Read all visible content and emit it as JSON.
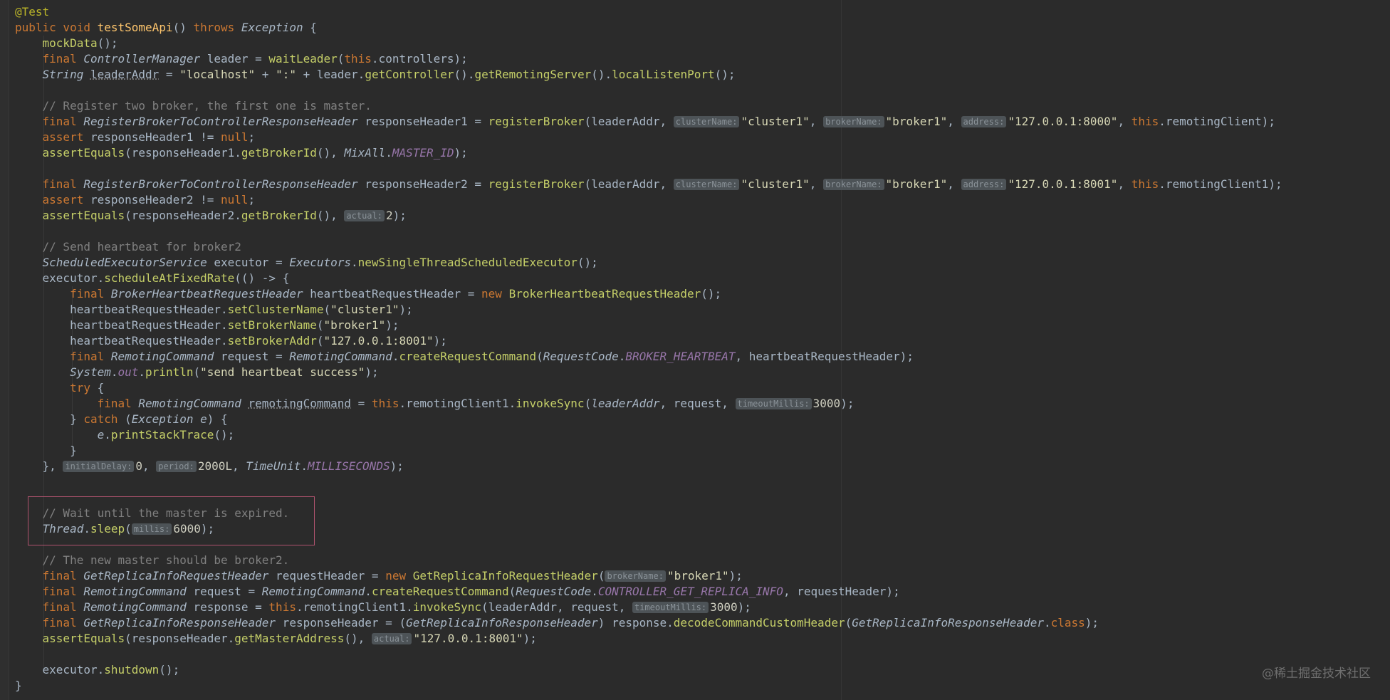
{
  "editor": {
    "watermark": "@稀土掘金技术社区",
    "lines": [
      [
        [
          "@Test",
          "ann"
        ]
      ],
      [
        [
          "public void ",
          "kw"
        ],
        [
          "testSomeApi",
          "fn"
        ],
        [
          "() "
        ],
        [
          "throws ",
          "kw"
        ],
        [
          "Exception",
          "type"
        ],
        [
          " {"
        ]
      ],
      [
        [
          "    "
        ],
        [
          "mockData",
          "call"
        ],
        [
          "();"
        ]
      ],
      [
        [
          "    "
        ],
        [
          "final ",
          "kw"
        ],
        [
          "ControllerManager",
          "type"
        ],
        [
          " leader = "
        ],
        [
          "waitLeader",
          "call"
        ],
        [
          "("
        ],
        [
          "this",
          "kw"
        ],
        [
          ".controllers);"
        ]
      ],
      [
        [
          "    "
        ],
        [
          "String",
          "type"
        ],
        [
          " "
        ],
        [
          "leaderAddr",
          "unused"
        ],
        [
          " = "
        ],
        [
          "\"localhost\"",
          "str"
        ],
        [
          " + "
        ],
        [
          "\":\"",
          "str"
        ],
        [
          " + leader."
        ],
        [
          "getController",
          "call"
        ],
        [
          "()."
        ],
        [
          "getRemotingServer",
          "call"
        ],
        [
          "()."
        ],
        [
          "localListenPort",
          "call"
        ],
        [
          "();"
        ]
      ],
      [],
      [
        [
          "    "
        ],
        [
          "// Register two broker, the first one is master.",
          "cmt"
        ]
      ],
      [
        [
          "    "
        ],
        [
          "final ",
          "kw"
        ],
        [
          "RegisterBrokerToControllerResponseHeader",
          "type"
        ],
        [
          " responseHeader1 = "
        ],
        [
          "registerBroker",
          "call"
        ],
        [
          "(leaderAddr, "
        ],
        [
          "clusterName:",
          "hint"
        ],
        [
          "\"cluster1\"",
          "str"
        ],
        [
          ", "
        ],
        [
          "brokerName:",
          "hint"
        ],
        [
          "\"broker1\"",
          "str"
        ],
        [
          ", "
        ],
        [
          "address:",
          "hint"
        ],
        [
          "\"127.0.0.1:8000\"",
          "str"
        ],
        [
          ", "
        ],
        [
          "this",
          "kw"
        ],
        [
          ".remotingClient);"
        ]
      ],
      [
        [
          "    "
        ],
        [
          "assert ",
          "kw"
        ],
        [
          "responseHeader1 != "
        ],
        [
          "null",
          "kw"
        ],
        [
          ";"
        ]
      ],
      [
        [
          "    "
        ],
        [
          "assertEquals",
          "call"
        ],
        [
          "(responseHeader1."
        ],
        [
          "getBrokerId",
          "call"
        ],
        [
          "(), "
        ],
        [
          "MixAll",
          "type"
        ],
        [
          "."
        ],
        [
          "MASTER_ID",
          "const"
        ],
        [
          ");"
        ]
      ],
      [],
      [
        [
          "    "
        ],
        [
          "final ",
          "kw"
        ],
        [
          "RegisterBrokerToControllerResponseHeader",
          "type"
        ],
        [
          " responseHeader2 = "
        ],
        [
          "registerBroker",
          "call"
        ],
        [
          "(leaderAddr, "
        ],
        [
          "clusterName:",
          "hint"
        ],
        [
          "\"cluster1\"",
          "str"
        ],
        [
          ", "
        ],
        [
          "brokerName:",
          "hint"
        ],
        [
          "\"broker1\"",
          "str"
        ],
        [
          ", "
        ],
        [
          "address:",
          "hint"
        ],
        [
          "\"127.0.0.1:8001\"",
          "str"
        ],
        [
          ", "
        ],
        [
          "this",
          "kw"
        ],
        [
          ".remotingClient1);"
        ]
      ],
      [
        [
          "    "
        ],
        [
          "assert ",
          "kw"
        ],
        [
          "responseHeader2 != "
        ],
        [
          "null",
          "kw"
        ],
        [
          ";"
        ]
      ],
      [
        [
          "    "
        ],
        [
          "assertEquals",
          "call"
        ],
        [
          "(responseHeader2."
        ],
        [
          "getBrokerId",
          "call"
        ],
        [
          "(), "
        ],
        [
          "actual:",
          "hint"
        ],
        [
          "2",
          "num"
        ],
        [
          ");"
        ]
      ],
      [],
      [
        [
          "    "
        ],
        [
          "// Send heartbeat for broker2",
          "cmt"
        ]
      ],
      [
        [
          "    "
        ],
        [
          "ScheduledExecutorService",
          "type"
        ],
        [
          " executor = "
        ],
        [
          "Executors",
          "type"
        ],
        [
          "."
        ],
        [
          "newSingleThreadScheduledExecutor",
          "call"
        ],
        [
          "();"
        ]
      ],
      [
        [
          "    executor."
        ],
        [
          "scheduleAtFixedRate",
          "call"
        ],
        [
          "(() -> {"
        ]
      ],
      [
        [
          "        "
        ],
        [
          "final ",
          "kw"
        ],
        [
          "BrokerHeartbeatRequestHeader",
          "type"
        ],
        [
          " heartbeatRequestHeader = "
        ],
        [
          "new ",
          "kw"
        ],
        [
          "BrokerHeartbeatRequestHeader",
          "call"
        ],
        [
          "();"
        ]
      ],
      [
        [
          "        heartbeatRequestHeader."
        ],
        [
          "setClusterName",
          "call"
        ],
        [
          "("
        ],
        [
          "\"cluster1\"",
          "str"
        ],
        [
          ");"
        ]
      ],
      [
        [
          "        heartbeatRequestHeader."
        ],
        [
          "setBrokerName",
          "call"
        ],
        [
          "("
        ],
        [
          "\"broker1\"",
          "str"
        ],
        [
          ");"
        ]
      ],
      [
        [
          "        heartbeatRequestHeader."
        ],
        [
          "setBrokerAddr",
          "call"
        ],
        [
          "("
        ],
        [
          "\"127.0.0.1:8001\"",
          "str"
        ],
        [
          ");"
        ]
      ],
      [
        [
          "        "
        ],
        [
          "final ",
          "kw"
        ],
        [
          "RemotingCommand",
          "type"
        ],
        [
          " request = "
        ],
        [
          "RemotingCommand",
          "type"
        ],
        [
          "."
        ],
        [
          "createRequestCommand",
          "call"
        ],
        [
          "("
        ],
        [
          "RequestCode",
          "type"
        ],
        [
          "."
        ],
        [
          "BROKER_HEARTBEAT",
          "const"
        ],
        [
          ", heartbeatRequestHeader);"
        ]
      ],
      [
        [
          "        "
        ],
        [
          "System",
          "type"
        ],
        [
          "."
        ],
        [
          "out",
          "const"
        ],
        [
          "."
        ],
        [
          "println",
          "call"
        ],
        [
          "("
        ],
        [
          "\"send heartbeat success\"",
          "str"
        ],
        [
          ");"
        ]
      ],
      [
        [
          "        "
        ],
        [
          "try ",
          "kw"
        ],
        [
          "{"
        ]
      ],
      [
        [
          "            "
        ],
        [
          "final ",
          "kw"
        ],
        [
          "RemotingCommand",
          "type"
        ],
        [
          " "
        ],
        [
          "remotingCommand",
          "unused"
        ],
        [
          " = "
        ],
        [
          "this",
          "kw"
        ],
        [
          ".remotingClient1."
        ],
        [
          "invokeSync",
          "call"
        ],
        [
          "("
        ],
        [
          "leaderAddr",
          "type"
        ],
        [
          ", request, "
        ],
        [
          "timeoutMillis:",
          "hint"
        ],
        [
          "3000",
          "num"
        ],
        [
          ");"
        ]
      ],
      [
        [
          "        } "
        ],
        [
          "catch ",
          "kw"
        ],
        [
          "("
        ],
        [
          "Exception",
          "type"
        ],
        [
          " "
        ],
        [
          "e",
          "type"
        ],
        [
          ") {"
        ]
      ],
      [
        [
          "            "
        ],
        [
          "e",
          "type"
        ],
        [
          "."
        ],
        [
          "printStackTrace",
          "call"
        ],
        [
          "();"
        ]
      ],
      [
        [
          "        }"
        ]
      ],
      [
        [
          "    }, "
        ],
        [
          "initialDelay:",
          "hint"
        ],
        [
          "0",
          "num"
        ],
        [
          ", "
        ],
        [
          "period:",
          "hint"
        ],
        [
          "2000L",
          "num"
        ],
        [
          ", "
        ],
        [
          "TimeUnit",
          "type"
        ],
        [
          "."
        ],
        [
          "MILLISECONDS",
          "const"
        ],
        [
          ");"
        ]
      ],
      [],
      [],
      [
        [
          "    "
        ],
        [
          "// Wait until the master is expired.",
          "cmt"
        ]
      ],
      [
        [
          "    "
        ],
        [
          "Thread",
          "type"
        ],
        [
          "."
        ],
        [
          "sleep",
          "call"
        ],
        [
          "("
        ],
        [
          "millis:",
          "hint"
        ],
        [
          "6000",
          "num"
        ],
        [
          ");"
        ]
      ],
      [],
      [
        [
          "    "
        ],
        [
          "// The new master should be broker2.",
          "cmt"
        ]
      ],
      [
        [
          "    "
        ],
        [
          "final ",
          "kw"
        ],
        [
          "GetReplicaInfoRequestHeader",
          "type"
        ],
        [
          " requestHeader = "
        ],
        [
          "new ",
          "kw"
        ],
        [
          "GetReplicaInfoRequestHeader",
          "call"
        ],
        [
          "("
        ],
        [
          "brokerName:",
          "hint"
        ],
        [
          "\"broker1\"",
          "str"
        ],
        [
          ");"
        ]
      ],
      [
        [
          "    "
        ],
        [
          "final ",
          "kw"
        ],
        [
          "RemotingCommand",
          "type"
        ],
        [
          " request = "
        ],
        [
          "RemotingCommand",
          "type"
        ],
        [
          "."
        ],
        [
          "createRequestCommand",
          "call"
        ],
        [
          "("
        ],
        [
          "RequestCode",
          "type"
        ],
        [
          "."
        ],
        [
          "CONTROLLER_GET_REPLICA_INFO",
          "const"
        ],
        [
          ", requestHeader);"
        ]
      ],
      [
        [
          "    "
        ],
        [
          "final ",
          "kw"
        ],
        [
          "RemotingCommand",
          "type"
        ],
        [
          " response = "
        ],
        [
          "this",
          "kw"
        ],
        [
          ".remotingClient1."
        ],
        [
          "invokeSync",
          "call"
        ],
        [
          "(leaderAddr, request, "
        ],
        [
          "timeoutMillis:",
          "hint"
        ],
        [
          "3000",
          "num"
        ],
        [
          ");"
        ]
      ],
      [
        [
          "    "
        ],
        [
          "final ",
          "kw"
        ],
        [
          "GetReplicaInfoResponseHeader",
          "type"
        ],
        [
          " responseHeader = ("
        ],
        [
          "GetReplicaInfoResponseHeader",
          "type"
        ],
        [
          ") response."
        ],
        [
          "decodeCommandCustomHeader",
          "call"
        ],
        [
          "("
        ],
        [
          "GetReplicaInfoResponseHeader",
          "type"
        ],
        [
          "."
        ],
        [
          "class",
          "kw"
        ],
        [
          ");"
        ]
      ],
      [
        [
          "    "
        ],
        [
          "assertEquals",
          "call"
        ],
        [
          "(responseHeader."
        ],
        [
          "getMasterAddress",
          "call"
        ],
        [
          "(), "
        ],
        [
          "actual:",
          "hint"
        ],
        [
          "\"127.0.0.1:8001\"",
          "str"
        ],
        [
          ");"
        ]
      ],
      [],
      [
        [
          "    executor."
        ],
        [
          "shutdown",
          "call"
        ],
        [
          "();"
        ]
      ],
      [
        [
          "}"
        ]
      ]
    ]
  }
}
